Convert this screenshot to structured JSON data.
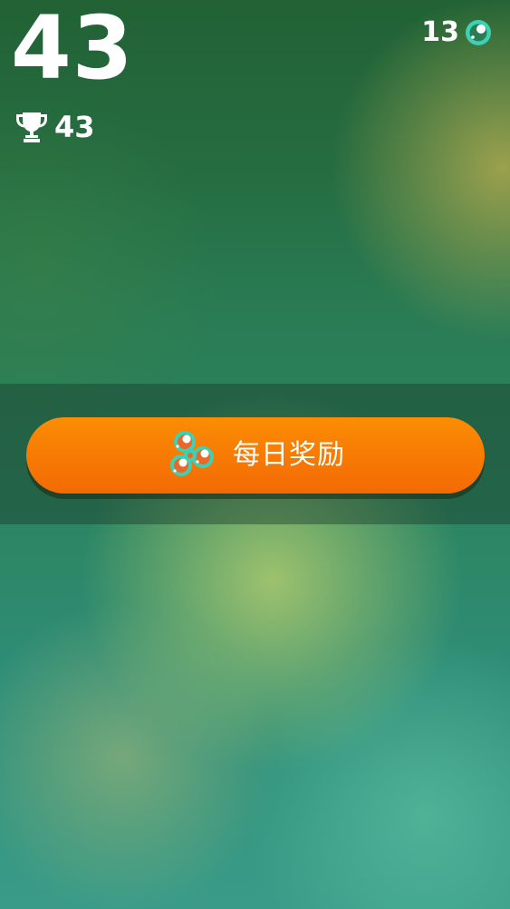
{
  "hud": {
    "score": "43",
    "best_score": "43",
    "coins": "13"
  },
  "daily_reward": {
    "label": "每日奖励"
  },
  "icons": {
    "best": "trophy-icon",
    "coins": "spinner-coin-icon",
    "reward": "fidget-spinner-icon"
  },
  "colors": {
    "button_orange": "#f77904",
    "accent_teal": "#3fd0b4",
    "background_green": "#256c40"
  }
}
